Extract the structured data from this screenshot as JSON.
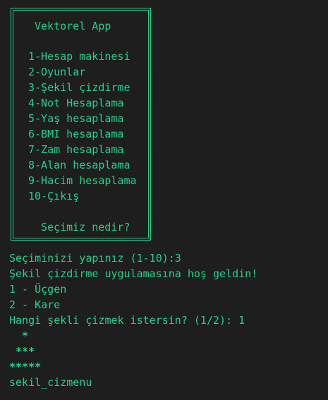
{
  "menu": {
    "title": "Vektorel App",
    "items": [
      "1-Hesap makinesi",
      "2-Oyunlar",
      "3-Şekil çizdirme",
      "4-Not Hesaplama",
      "5-Yaş hesaplama",
      "6-BMI hesaplama",
      "7-Zam hesaplama",
      "8-Alan hesaplama",
      "9-Hacim hesaplama",
      "10-Çıkış"
    ],
    "prompt": "Seçimiz nedir?"
  },
  "output": {
    "lines": [
      "Seçiminizi yapınız (1-10):3",
      "Şekil çizdirme uygulamasına hoş geldin!",
      "1 - Üçgen",
      "2 - Kare",
      "Hangi şekli çizmek istersin? (1/2): 1",
      "  *",
      " ***",
      "*****",
      "sekil_cizmenu",
      "  _____ _ ____ __ _ _ __  _ __ ___"
    ]
  },
  "colors": {
    "background": "#1e1e1e",
    "text": "#23d18b"
  }
}
